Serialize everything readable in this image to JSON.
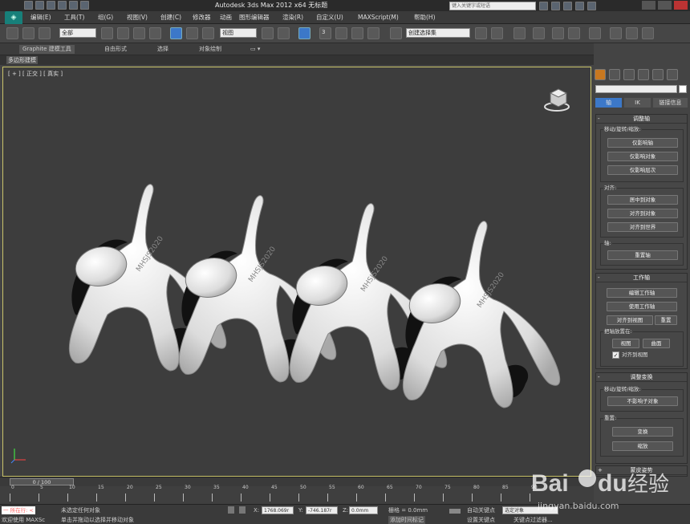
{
  "title_bar": {
    "app_title": "Autodesk 3ds Max  2012 x64     无标题",
    "search_placeholder": "键入关键字或短语"
  },
  "menu": [
    "编辑(E)",
    "工具(T)",
    "组(G)",
    "视图(V)",
    "创建(C)",
    "修改器",
    "动画",
    "图形编辑器",
    "渲染(R)",
    "自定义(U)",
    "MAXScript(M)",
    "帮助(H)"
  ],
  "toolbar": {
    "selection_filter": "全部",
    "reference_coord": "视图",
    "named_selection": "创建选择集",
    "snap_label": "3"
  },
  "ribbon": {
    "tabs": [
      "Graphite 建模工具",
      "自由形式",
      "选择",
      "对象绘制"
    ],
    "sub_label": "多边形建模"
  },
  "viewport": {
    "label": "[ + ] [ 正交 ] [ 真实 ]",
    "model_text": "MHSJS2020"
  },
  "command_panel": {
    "subtabs": [
      "轴",
      "IK",
      "链接信息"
    ],
    "adjust_pivot": {
      "title": "调整轴",
      "move_group": "移动/旋转/缩放:",
      "buttons": [
        "仅影响轴",
        "仅影响对象",
        "仅影响层次"
      ],
      "align_group": "对齐:",
      "align_buttons": [
        "居中到对象",
        "对齐到对象",
        "对齐到世界"
      ],
      "pivot_group": "轴:",
      "reset_pivot": "重置轴"
    },
    "working_pivot": {
      "title": "工作轴",
      "buttons": [
        "编辑工作轴",
        "使用工作轴"
      ],
      "align_view": "对齐到视图",
      "reset": "重置",
      "place_group": "把轴放置在:",
      "place_buttons": [
        "视图",
        "曲面"
      ],
      "align_check": "对齐到视图"
    },
    "adjust_transform": {
      "title": "调整变换",
      "move_group": "移动/旋转/缩放:",
      "dont_affect": "不影响子对象",
      "reset_group": "重置:",
      "reset_buttons": [
        "变换",
        "缩放"
      ]
    },
    "skin_pose": {
      "title": "蒙皮姿势"
    }
  },
  "timeline": {
    "thumb": "0 / 100",
    "ticks": [
      "0",
      "5",
      "10",
      "15",
      "20",
      "25",
      "30",
      "35",
      "40",
      "45",
      "50",
      "55",
      "60",
      "65",
      "70",
      "75",
      "80",
      "85",
      "90"
    ]
  },
  "status": {
    "selection": "未选定任何对象",
    "prompt": "单击并拖动以选择并移动对象",
    "x": "1768.069r",
    "y": "-746.187r",
    "z": "0.0mm",
    "grid": "栅格 = 0.0mm",
    "autokey": "自动关键点",
    "selected": "选定对象",
    "setkey": "设置关键点",
    "keyfilter": "关键点过滤器...",
    "addtime": "添加时间标记",
    "maxscript": "欢迎使用 MAXSc",
    "welcome": "一  所在行: <"
  },
  "watermark": {
    "brand": "Bai",
    "brand2": "du",
    "jingyan": "经验",
    "url": "jingyan.baidu.com"
  },
  "colors": {
    "viewport_bg": "#3d3d3d",
    "active_tab": "#3c78c8",
    "viewport_border": "#c9c36a"
  }
}
